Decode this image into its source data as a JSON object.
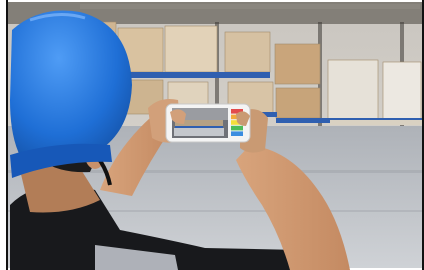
{
  "scene": {
    "description_icon": "warehouse-photo",
    "colors": {
      "helmet": "#1f6fd6",
      "pallet_blue": "#2f5fb0",
      "floor": "#b9bcc2",
      "cardboard": "#c9b08c",
      "wall": "#d9d5cf"
    }
  },
  "phone_screen": {
    "swatches": [
      "#e34b4b",
      "#f2a93b",
      "#f5de3b",
      "#4dbb59",
      "#3b8de0"
    ]
  }
}
